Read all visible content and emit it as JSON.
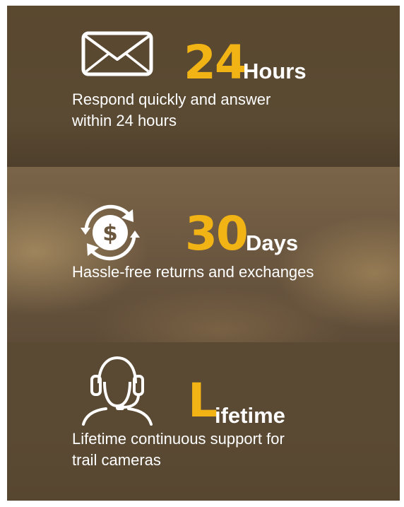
{
  "sections": [
    {
      "icon": "envelope-icon",
      "number": "24",
      "unit": "Hours",
      "description_line1": "Respond quickly and answer",
      "description_line2": "within 24 hours"
    },
    {
      "icon": "dollar-refresh-icon",
      "number": "30",
      "unit": "Days",
      "description_line1": "Hassle-free returns and exchanges"
    },
    {
      "icon": "headset-support-icon",
      "number": "L",
      "unit": "ifetime",
      "description_line1": "Lifetime continuous support for",
      "description_line2": "trail cameras"
    }
  ],
  "colors": {
    "accent": "#f2b315",
    "text": "#ffffff",
    "background": "#5a482f"
  }
}
